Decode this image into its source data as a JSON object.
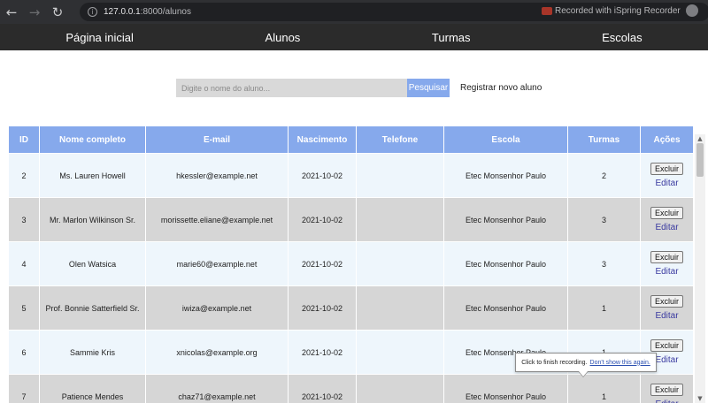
{
  "browser": {
    "url_host": "127.0.0.1",
    "url_path": ":8000/alunos",
    "recording_text": "Recorded with iSpring Recorder"
  },
  "nav": {
    "home": "Página inicial",
    "students": "Alunos",
    "classes": "Turmas",
    "schools": "Escolas"
  },
  "search": {
    "placeholder": "Digite o nome do aluno...",
    "button": "Pesquisar",
    "register": "Registrar novo aluno"
  },
  "table": {
    "headers": [
      "ID",
      "Nome completo",
      "E-mail",
      "Nascimento",
      "Telefone",
      "Escola",
      "Turmas",
      "Ações"
    ],
    "delete_label": "Excluir",
    "edit_label": "Editar",
    "rows": [
      {
        "id": "2",
        "name": "Ms. Lauren Howell",
        "email": "hkessler@example.net",
        "birth": "2021-10-02",
        "phone": "",
        "school": "Etec Monsenhor Paulo",
        "classes": "2"
      },
      {
        "id": "3",
        "name": "Mr. Marlon Wilkinson Sr.",
        "email": "morissette.eliane@example.net",
        "birth": "2021-10-02",
        "phone": "",
        "school": "Etec Monsenhor Paulo",
        "classes": "3"
      },
      {
        "id": "4",
        "name": "Olen Watsica",
        "email": "marie60@example.net",
        "birth": "2021-10-02",
        "phone": "",
        "school": "Etec Monsenhor Paulo",
        "classes": "3"
      },
      {
        "id": "5",
        "name": "Prof. Bonnie Satterfield Sr.",
        "email": "iwiza@example.net",
        "birth": "2021-10-02",
        "phone": "",
        "school": "Etec Monsenhor Paulo",
        "classes": "1"
      },
      {
        "id": "6",
        "name": "Sammie Kris",
        "email": "xnicolas@example.org",
        "birth": "2021-10-02",
        "phone": "",
        "school": "Etec Monsenhor Paulo",
        "classes": "1"
      },
      {
        "id": "7",
        "name": "Patience Mendes",
        "email": "chaz71@example.net",
        "birth": "2021-10-02",
        "phone": "",
        "school": "Etec Monsenhor Paulo",
        "classes": "1"
      }
    ]
  },
  "tooltip": {
    "text": "Click to finish recording.",
    "hide": "Don't show this again."
  },
  "colors": {
    "header_bg": "#86a9ec",
    "nav_bg": "#2b2b2b",
    "row_light": "#eef6fc",
    "row_dark": "#d6d6d6"
  }
}
